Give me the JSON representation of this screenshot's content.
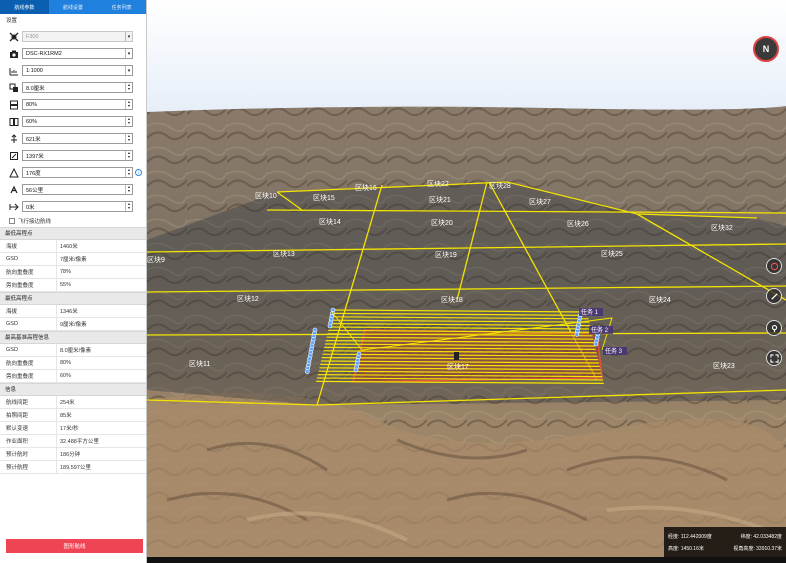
{
  "tabs": [
    "航线参数",
    "航线设置",
    "任务列表"
  ],
  "settings_title": "设置",
  "fields": {
    "aircraft": "F300",
    "camera": "DSC-RX1RM2",
    "scale": "1:1000",
    "gsd": "8.0厘米",
    "overlap_forward": "80%",
    "overlap_side": "60%",
    "flight_height": "621米",
    "altitude": "1397米",
    "heading": "176度",
    "speed": "56公里",
    "extend": "0米"
  },
  "checkbox_label": "飞行接边航线",
  "groups": [
    {
      "title": "最低高程点",
      "rows": [
        [
          "海拔",
          "1460米"
        ],
        [
          "GSD",
          "7厘米/像素"
        ],
        [
          "航向重叠度",
          "78%"
        ],
        [
          "旁向重叠度",
          "55%"
        ]
      ]
    },
    {
      "title": "最低高程点",
      "rows": [
        [
          "海拔",
          "1346米"
        ],
        [
          "GSD",
          "9厘米/像素"
        ]
      ]
    },
    {
      "title": "最高基准高程信息",
      "rows": [
        [
          "GSD",
          "8.0厘米/像素"
        ],
        [
          "航向重叠度",
          "80%"
        ],
        [
          "旁向重叠度",
          "60%"
        ]
      ]
    },
    {
      "title": "信息",
      "rows": [
        [
          "航线间距",
          "254米"
        ],
        [
          "拍照间距",
          "85米"
        ],
        [
          "默认变速",
          "17米/秒"
        ],
        [
          "作业面积",
          "32.488平方公里"
        ],
        [
          "预计航时",
          "186分钟"
        ],
        [
          "预计航程",
          "189.597公里"
        ]
      ]
    }
  ],
  "generate_button": "图形航线",
  "map": {
    "block_labels": [
      "区块10",
      "区块15",
      "区块16",
      "区块22",
      "区块28",
      "区块21",
      "区块27",
      "区块14",
      "区块20",
      "区块26",
      "区块32",
      "区块13",
      "区块19",
      "区块25",
      "区块12",
      "区块18",
      "区块24",
      "区块11",
      "区块17",
      "区块23",
      "区块9"
    ],
    "task_labels": [
      "任务 1",
      "任务 2",
      "任务 3"
    ],
    "compass": "N",
    "coords": {
      "lon": "经度: 112.442009度",
      "lat": "纬度: 42.033482度",
      "height": "高度: 1450.16米",
      "view": "视角高度: 33910.37米"
    }
  },
  "colors": {
    "tab_bar": "#1f80dd",
    "tab_active": "#0b5fb0",
    "grid_line": "#f4e400",
    "flight_line": "#f4e400",
    "selected_block": "#c0392b",
    "button": "#ef4454"
  },
  "icons": [
    "airplane-icon",
    "camera-icon",
    "scale-icon",
    "gsd-icon",
    "overlap-forward-icon",
    "overlap-side-icon",
    "height-icon",
    "altitude-icon",
    "heading-icon",
    "speed-icon",
    "extend-icon"
  ]
}
